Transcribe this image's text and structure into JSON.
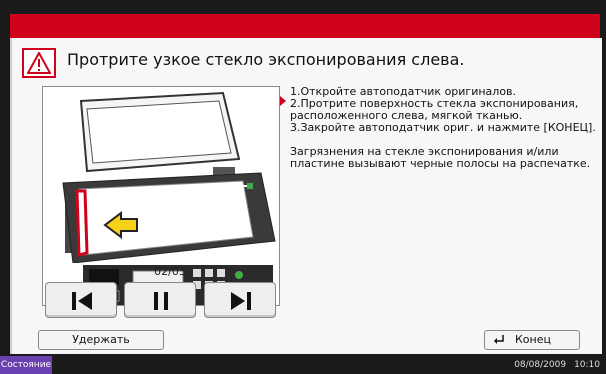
{
  "header": {
    "title": "Протрите узкое стекло экспонирования слева.",
    "warning_icon": "warning-triangle-icon"
  },
  "illustration": {
    "icon": "scanner-glass-illustration",
    "counter": "02/03"
  },
  "navigation": {
    "first_icon": "skip-to-start-icon",
    "pause_icon": "pause-icon",
    "next_icon": "skip-to-end-icon"
  },
  "instructions": {
    "steps": [
      "1.Откройте автоподатчик оригиналов.",
      "2.Протрите поверхность стекла экспонирования,",
      "расположенного слева, мягкой тканью.",
      "3.Закройте автоподатчик ориг. и нажмите [КОНЕЦ]."
    ],
    "note": [
      "Загрязнения на стекле экспонирования и/или",
      "пластине вызывают черные полосы на распечатке."
    ],
    "current_step_marker_color": "#d0021b"
  },
  "footer": {
    "hold_label": "Удержать",
    "end_label": "Конец",
    "end_icon": "enter-icon"
  },
  "status_bar": {
    "status_label": "Состояние",
    "date": "08/08/2009",
    "time": "10:10"
  },
  "colors": {
    "accent_red": "#d0021b",
    "status_purple": "#6a3fb0",
    "frame_dark": "#1a1a1a"
  }
}
